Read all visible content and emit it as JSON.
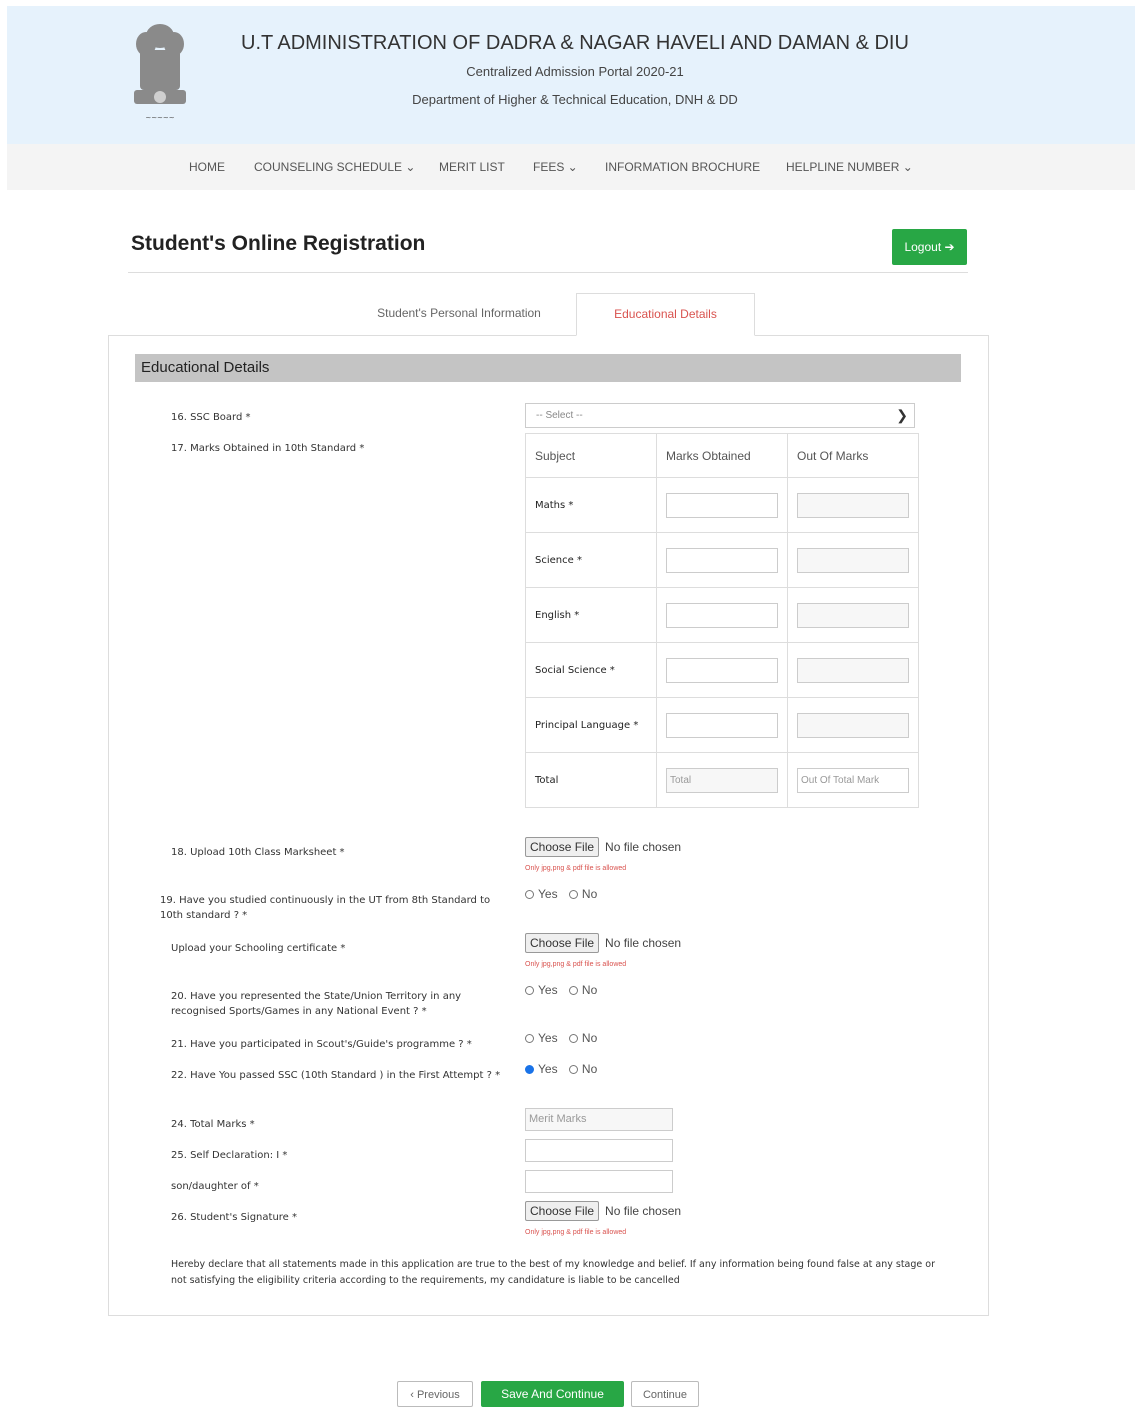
{
  "header": {
    "title": "U.T ADMINISTRATION OF DADRA & NAGAR HAVELI AND DAMAN & DIU",
    "subtitle1": "Centralized Admission Portal 2020-21",
    "subtitle2": "Department of Higher & Technical Education, DNH & DD",
    "emblem_icon": "national-emblem-icon"
  },
  "nav": {
    "home": "HOME",
    "counseling": "COUNSELING SCHEDULE ⌄",
    "merit": "MERIT LIST",
    "fees": "FEES ⌄",
    "brochure": "INFORMATION BROCHURE",
    "helpline": "HELPLINE NUMBER ⌄"
  },
  "page": {
    "title": "Student's Online Registration",
    "logout": "Logout ➔"
  },
  "tabs": {
    "personal": "Student's Personal Information",
    "educational": "Educational Details"
  },
  "section": {
    "title": "Educational Details"
  },
  "form": {
    "ssc_board_label": "16. SSC Board *",
    "ssc_board_value": "-- Select --",
    "marks_label": "17. Marks Obtained in 10th Standard *",
    "table": {
      "col_subject": "Subject",
      "col_marks": "Marks Obtained",
      "col_out": "Out Of Marks",
      "rows": [
        "Maths *",
        "Science *",
        "English *",
        "Social Science *",
        "Principal Language *"
      ],
      "total_label": "Total",
      "total_placeholder": "Total",
      "out_total_placeholder": "Out Of Total Mark"
    },
    "upload_marksheet_label": "18. Upload 10th Class Marksheet *",
    "choose_file": "Choose File",
    "no_file": "No file chosen",
    "file_note": "Only jpg,png & pdf file is allowed",
    "q19_label": "19. Have you studied continuously in the UT from 8th Standard to 10th standard ? *",
    "schooling_label": "Upload your Schooling certificate *",
    "q20_label": "20. Have you represented the State/Union Territory in any recognised Sports/Games in any National Event ? *",
    "q21_label": "21. Have you participated in Scout's/Guide's programme ? *",
    "q22_label": "22. Have You passed SSC (10th Standard ) in the First Attempt ? *",
    "yes": "Yes",
    "no": "No",
    "total_marks_label": "24. Total Marks *",
    "total_marks_placeholder": "Merit Marks",
    "self_decl_label": "25. Self Declaration: I *",
    "son_daughter_label": "son/daughter of *",
    "signature_label": "26. Student's Signature *",
    "declaration": "Hereby declare that all statements made in this application are true to the best of my knowledge and belief. If any information being found false at any stage or not satisfying the eligibility criteria according to the requirements, my candidature is liable to be cancelled"
  },
  "buttons": {
    "previous": "‹ Previous",
    "save": "Save And Continue",
    "continue": "Continue"
  },
  "colors": {
    "header_bg": "#e6f2fc",
    "accent_green": "#28a745",
    "tab_active": "#d9534f"
  }
}
